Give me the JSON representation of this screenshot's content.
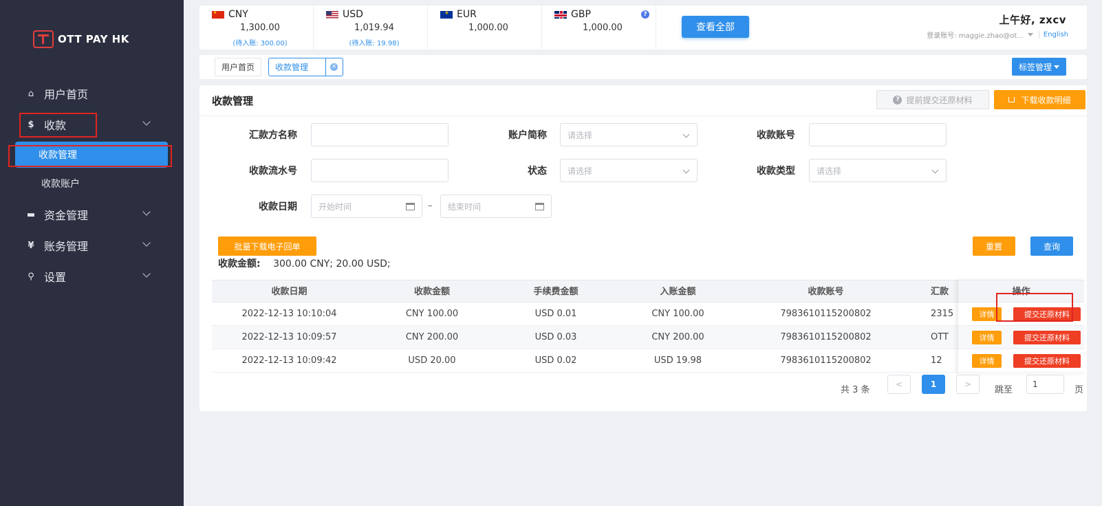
{
  "brand": {
    "logo_text": "OTT PAY HK"
  },
  "sidebar": {
    "items": [
      {
        "label": "用户首页",
        "icon": "home-icon"
      },
      {
        "label": "收款",
        "icon": "dollar-icon"
      },
      {
        "label": "资金管理",
        "icon": "card-icon"
      },
      {
        "label": "账务管理",
        "icon": "yen-icon"
      },
      {
        "label": "设置",
        "icon": "search-icon"
      }
    ],
    "sub_items": [
      {
        "label": "收款管理",
        "active": true
      },
      {
        "label": "收款账户",
        "active": false
      }
    ]
  },
  "accounts": [
    {
      "code": "CNY",
      "amount": "1,300.00",
      "pending": "(待入账: 300.00)"
    },
    {
      "code": "USD",
      "amount": "1,019.94",
      "pending": "(待入账: 19.98)"
    },
    {
      "code": "EUR",
      "amount": "1,000.00",
      "pending": ""
    },
    {
      "code": "GBP",
      "amount": "1,000.00",
      "pending": ""
    }
  ],
  "topbar": {
    "view_all": "查看全部",
    "greeting": "上午好, zxcv",
    "login_label": "登录账号: maggie.zhao@ot...",
    "language": "English"
  },
  "tabs": {
    "home": "用户首页",
    "current": "收款管理",
    "close_glyph": "×",
    "tag_manage": "标签管理"
  },
  "card": {
    "title": "收款管理",
    "pre_submit": "提前提交还原材料",
    "download": "下载收款明细",
    "help_glyph": "?"
  },
  "filters": {
    "payer_name": "汇款方名称",
    "account_short": "账户简称",
    "receive_account": "收款账号",
    "serial_no": "收款流水号",
    "status": "状态",
    "receive_type": "收款类型",
    "receive_date": "收款日期",
    "select_placeholder": "请选择",
    "start_placeholder": "开始时间",
    "end_placeholder": "结束时间",
    "date_sep": "–"
  },
  "actions": {
    "batch": "批量下载电子回单",
    "reset": "重置",
    "query": "查询"
  },
  "summary": {
    "label": "收款金额:",
    "value": "300.00 CNY; 20.00 USD;"
  },
  "table": {
    "columns": [
      "收款日期",
      "收款金额",
      "手续费金额",
      "入账金额",
      "收款账号",
      "汇款"
    ],
    "op_header": "操作",
    "rows": [
      [
        "2022-12-13 10:10:04",
        "CNY 100.00",
        "USD 0.01",
        "CNY 100.00",
        "7983610115200802",
        "2315"
      ],
      [
        "2022-12-13 10:09:57",
        "CNY 200.00",
        "USD 0.03",
        "CNY 200.00",
        "7983610115200802",
        "OTT"
      ],
      [
        "2022-12-13 10:09:42",
        "USD 20.00",
        "USD 0.02",
        "USD 19.98",
        "7983610115200802",
        "12"
      ]
    ],
    "detail_label": "详情",
    "submit_label": "提交还原材料"
  },
  "pagination": {
    "total": "共 3 条",
    "prev": "<",
    "current": "1",
    "next": ">",
    "jump_label": "跳至",
    "jump_value": "1",
    "page_suffix": "页"
  },
  "colors": {
    "sidebar_bg": "#2c2f3f",
    "primary": "#2f8fea",
    "warning": "#ff9d0b",
    "danger": "#ee3e24",
    "highlight_box": "#e0241f"
  }
}
